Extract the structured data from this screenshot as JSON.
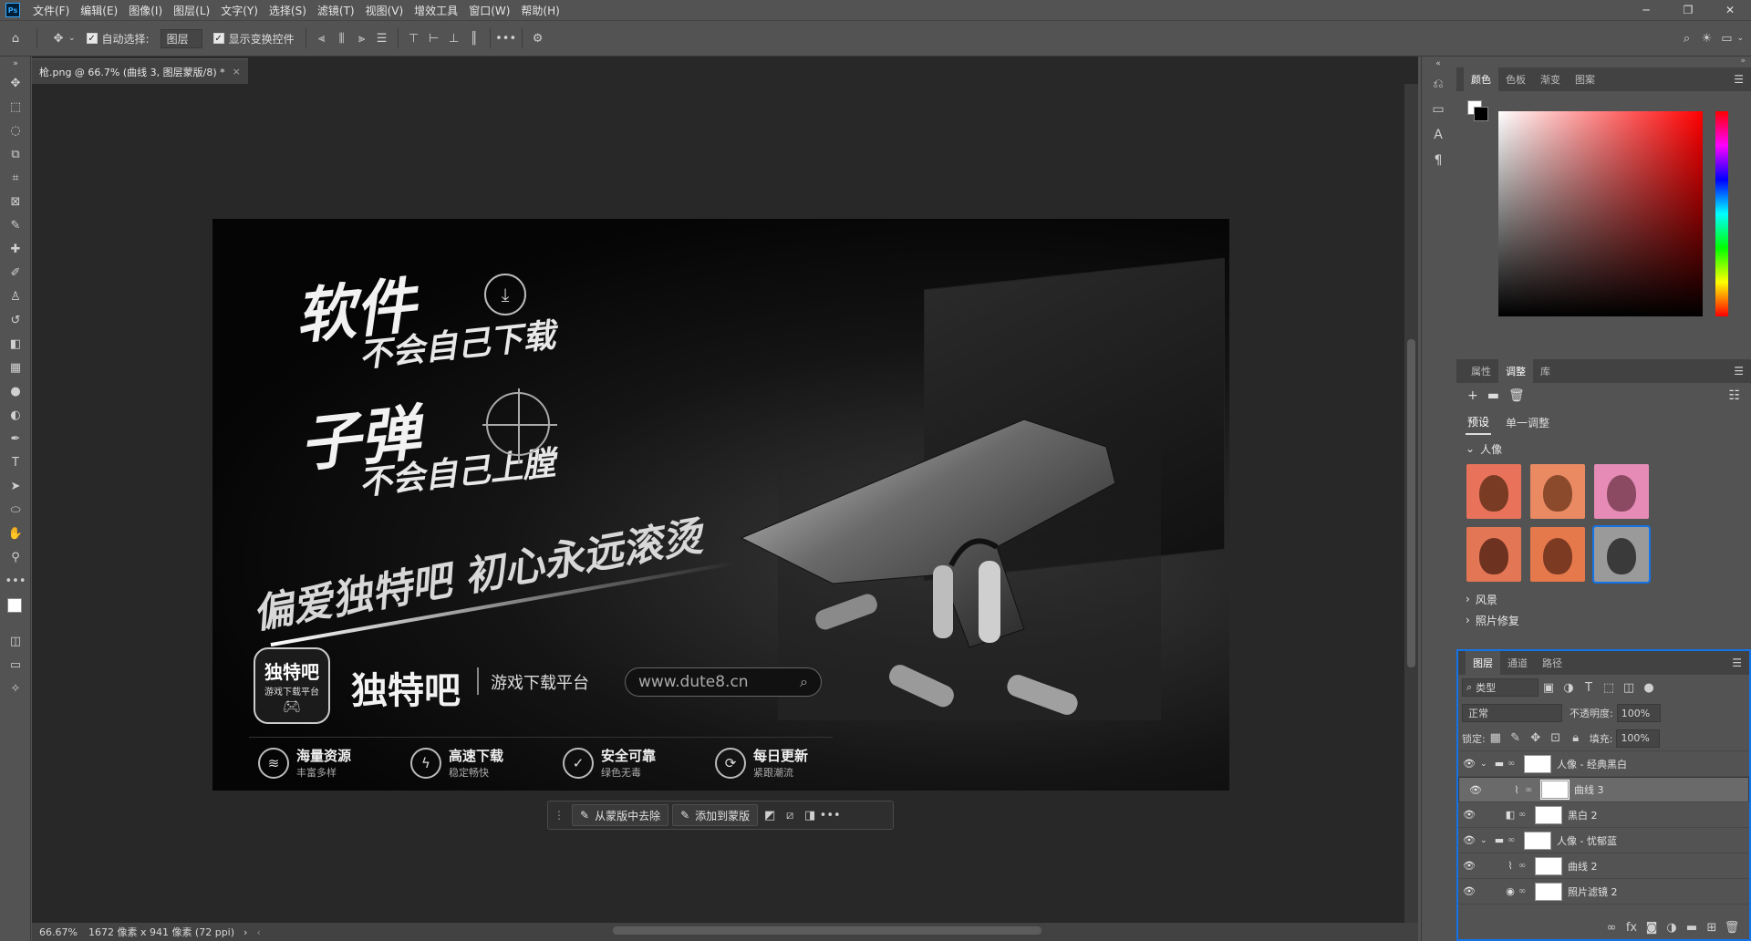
{
  "menubar": {
    "items": [
      "文件(F)",
      "编辑(E)",
      "图像(I)",
      "图层(L)",
      "文字(Y)",
      "选择(S)",
      "滤镜(T)",
      "视图(V)",
      "增效工具",
      "窗口(W)",
      "帮助(H)"
    ]
  },
  "options": {
    "auto_select_label": "自动选择:",
    "auto_select_value": "图层",
    "show_transform_label": "显示变换控件"
  },
  "document": {
    "tab_title": "枪.png @ 66.7% (曲线 3, 图层蒙版/8) *"
  },
  "canvas_art": {
    "line1": "软件",
    "line1b": "不会自己下载",
    "line2": "子弹",
    "line2b": "不会自己上膛",
    "slogan": "偏爱独特吧 初心永远滚烫",
    "logo_line1": "独特吧",
    "logo_line2": "游戏下载平台",
    "brand": "独特吧",
    "brand_sub": "游戏下载平台",
    "url": "www.dute8.cn",
    "features": [
      {
        "title": "海量资源",
        "sub": "丰富多样",
        "icon": "≋"
      },
      {
        "title": "高速下载",
        "sub": "稳定畅快",
        "icon": "ϟ"
      },
      {
        "title": "安全可靠",
        "sub": "绿色无毒",
        "icon": "✓"
      },
      {
        "title": "每日更新",
        "sub": "紧跟潮流",
        "icon": "⟳"
      }
    ]
  },
  "contextbar": {
    "remove_label": "从蒙版中去除",
    "add_label": "添加到蒙版"
  },
  "status": {
    "zoom": "66.67%",
    "doc_info": "1672 像素 x 941 像素 (72 ppi)"
  },
  "color_panel": {
    "tabs": [
      "颜色",
      "色板",
      "渐变",
      "图案"
    ]
  },
  "adjust_panel": {
    "tabs": [
      "属性",
      "调整",
      "库"
    ],
    "subtabs": [
      "预设",
      "单一调整"
    ],
    "group_portrait": "人像",
    "group_landscape": "风景",
    "group_photo": "照片修复"
  },
  "layers_panel": {
    "tabs": [
      "图层",
      "通道",
      "路径"
    ],
    "filter_label": "类型",
    "blend_mode": "正常",
    "opacity_label": "不透明度:",
    "opacity_value": "100%",
    "lock_label": "锁定:",
    "fill_label": "填充:",
    "fill_value": "100%",
    "layers": [
      {
        "name": "人像 - 经典黑白",
        "type": "group",
        "indent": 0,
        "selected": false
      },
      {
        "name": "曲线 3",
        "type": "curves",
        "indent": 1,
        "selected": true
      },
      {
        "name": "黑白 2",
        "type": "bw",
        "indent": 1,
        "selected": false
      },
      {
        "name": "人像 - 忧郁蓝",
        "type": "group",
        "indent": 0,
        "selected": false
      },
      {
        "name": "曲线 2",
        "type": "curves",
        "indent": 1,
        "selected": false
      },
      {
        "name": "照片滤镜 2",
        "type": "photo",
        "indent": 1,
        "selected": false
      }
    ]
  }
}
